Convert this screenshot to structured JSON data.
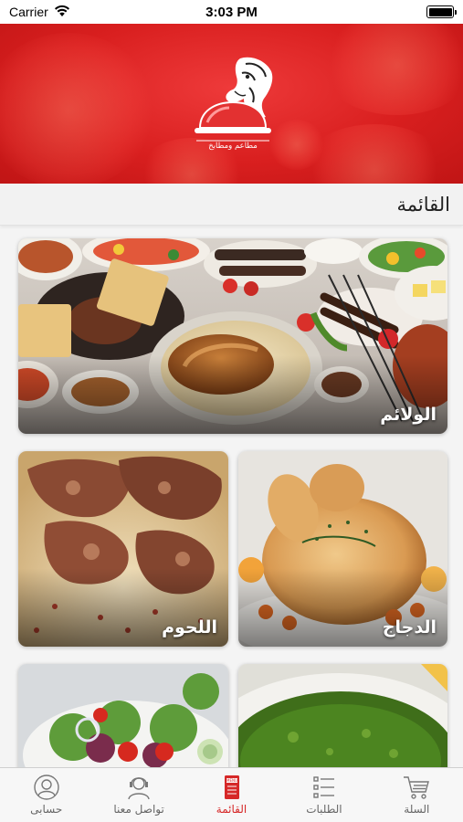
{
  "status_bar": {
    "carrier": "Carrier",
    "time": "3:03 PM"
  },
  "header": {
    "section_title": "القائمة"
  },
  "menu": {
    "categories": [
      {
        "label": "الولائم"
      },
      {
        "label": "الدجاج"
      },
      {
        "label": "اللحوم"
      },
      {
        "label": ""
      },
      {
        "label": ""
      }
    ]
  },
  "tab_bar": {
    "tabs": [
      {
        "label": "حسابى",
        "icon": "account-icon",
        "active": false
      },
      {
        "label": "تواصل معنا",
        "icon": "support-icon",
        "active": false
      },
      {
        "label": "القائمة",
        "icon": "menu-icon",
        "active": true
      },
      {
        "label": "الطلبات",
        "icon": "orders-list-icon",
        "active": false
      },
      {
        "label": "السلة",
        "icon": "cart-icon",
        "active": false
      }
    ]
  },
  "colors": {
    "brand_red": "#d91f1f",
    "active_tab": "#d62828",
    "inactive_tab": "#666666"
  }
}
